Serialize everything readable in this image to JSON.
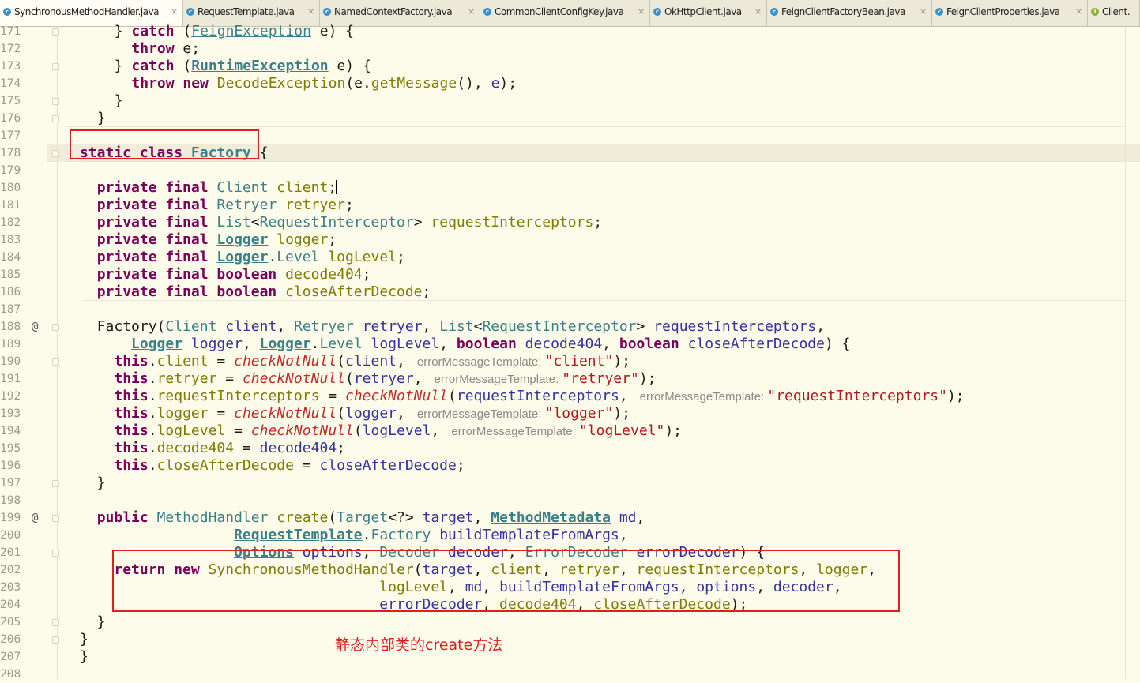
{
  "tabs": [
    {
      "label": "SynchronousMethodHandler.java",
      "icon": "class-icon",
      "active": true,
      "closable": true
    },
    {
      "label": "RequestTemplate.java",
      "icon": "class-icon",
      "closable": true
    },
    {
      "label": "NamedContextFactory.java",
      "icon": "class-icon",
      "closable": true
    },
    {
      "label": "CommonClientConfigKey.java",
      "icon": "class-icon",
      "closable": true
    },
    {
      "label": "OkHttpClient.java",
      "icon": "class-icon",
      "closable": true
    },
    {
      "label": "FeignClientFactoryBean.java",
      "icon": "class-icon",
      "closable": true
    },
    {
      "label": "FeignClientProperties.java",
      "icon": "class-icon",
      "closable": true
    },
    {
      "label": "Client.",
      "icon": "interface-icon",
      "closable": false
    }
  ],
  "tab_close_glyph": "×",
  "gutter_marks": {
    "188": "@",
    "199": "@"
  },
  "current_line": "180",
  "lines": [
    {
      "n": "171",
      "tokens": [
        [
          "  } ",
          ""
        ],
        [
          "catch",
          "kw"
        ],
        [
          " (",
          ""
        ],
        [
          "FeignException",
          "ty ul"
        ],
        [
          " e) {",
          ""
        ]
      ]
    },
    {
      "n": "172",
      "tokens": [
        [
          "    ",
          ""
        ],
        [
          "throw",
          "kw"
        ],
        [
          " e;",
          ""
        ]
      ]
    },
    {
      "n": "173",
      "tokens": [
        [
          "  } ",
          ""
        ],
        [
          "catch",
          "kw"
        ],
        [
          " (",
          ""
        ],
        [
          "RuntimeException",
          "ty ul bt"
        ],
        [
          " e) {",
          ""
        ]
      ]
    },
    {
      "n": "174",
      "tokens": [
        [
          "    ",
          ""
        ],
        [
          "throw new",
          "kw"
        ],
        [
          " ",
          ""
        ],
        [
          "DecodeException",
          "fn"
        ],
        [
          "(e.",
          ""
        ],
        [
          "getMessage",
          "fn"
        ],
        [
          "(), ",
          ""
        ],
        [
          "e",
          "fd"
        ],
        [
          ");",
          ""
        ]
      ]
    },
    {
      "n": "175",
      "tokens": [
        [
          "  }",
          ""
        ]
      ]
    },
    {
      "n": "176",
      "tokens": [
        [
          "}",
          ""
        ]
      ]
    },
    {
      "n": "177",
      "tokens": []
    },
    {
      "n": "178",
      "tokens": [
        [
          "static class",
          "kw"
        ],
        [
          " ",
          ""
        ],
        [
          "Factory",
          "ty ul bt"
        ],
        [
          " {",
          ""
        ]
      ]
    },
    {
      "n": "179",
      "tokens": []
    },
    {
      "n": "180",
      "tokens": [
        [
          "  ",
          ""
        ],
        [
          "private final",
          "kw"
        ],
        [
          " ",
          ""
        ],
        [
          "Client",
          "ty"
        ],
        [
          " ",
          ""
        ],
        [
          "client",
          "fn"
        ],
        [
          ";",
          ""
        ]
      ],
      "caret": true
    },
    {
      "n": "181",
      "tokens": [
        [
          "  ",
          ""
        ],
        [
          "private final",
          "kw"
        ],
        [
          " ",
          ""
        ],
        [
          "Retryer",
          "ty"
        ],
        [
          " ",
          ""
        ],
        [
          "retryer",
          "fn"
        ],
        [
          ";",
          ""
        ]
      ]
    },
    {
      "n": "182",
      "tokens": [
        [
          "  ",
          ""
        ],
        [
          "private final",
          "kw"
        ],
        [
          " ",
          ""
        ],
        [
          "List",
          "ty"
        ],
        [
          "<",
          ""
        ],
        [
          "RequestInterceptor",
          "ty"
        ],
        [
          "> ",
          ""
        ],
        [
          "requestInterceptors",
          "fn"
        ],
        [
          ";",
          ""
        ]
      ]
    },
    {
      "n": "183",
      "tokens": [
        [
          "  ",
          ""
        ],
        [
          "private final",
          "kw"
        ],
        [
          " ",
          ""
        ],
        [
          "Logger",
          "ty ul bt"
        ],
        [
          " ",
          ""
        ],
        [
          "logger",
          "fn"
        ],
        [
          ";",
          ""
        ]
      ]
    },
    {
      "n": "184",
      "tokens": [
        [
          "  ",
          ""
        ],
        [
          "private final",
          "kw"
        ],
        [
          " ",
          ""
        ],
        [
          "Logger",
          "ty ul bt"
        ],
        [
          ".",
          ""
        ],
        [
          "Level",
          "ty"
        ],
        [
          " ",
          ""
        ],
        [
          "logLevel",
          "fn"
        ],
        [
          ";",
          ""
        ]
      ]
    },
    {
      "n": "185",
      "tokens": [
        [
          "  ",
          ""
        ],
        [
          "private final boolean",
          "kw"
        ],
        [
          " ",
          ""
        ],
        [
          "decode404",
          "fn"
        ],
        [
          ";",
          ""
        ]
      ]
    },
    {
      "n": "186",
      "tokens": [
        [
          "  ",
          ""
        ],
        [
          "private final boolean",
          "kw"
        ],
        [
          " ",
          ""
        ],
        [
          "closeAfterDecode",
          "fn"
        ],
        [
          ";",
          ""
        ]
      ]
    },
    {
      "n": "187",
      "tokens": []
    },
    {
      "n": "188",
      "tokens": [
        [
          "  ",
          ""
        ],
        [
          "Factory",
          ""
        ],
        [
          "(",
          ""
        ],
        [
          "Client",
          "ty"
        ],
        [
          " ",
          ""
        ],
        [
          "client",
          "fd"
        ],
        [
          ", ",
          ""
        ],
        [
          "Retryer",
          "ty"
        ],
        [
          " ",
          ""
        ],
        [
          "retryer",
          "fd"
        ],
        [
          ", ",
          ""
        ],
        [
          "List",
          "ty"
        ],
        [
          "<",
          ""
        ],
        [
          "RequestInterceptor",
          "ty"
        ],
        [
          "> ",
          ""
        ],
        [
          "requestInterceptors",
          "fd"
        ],
        [
          ",",
          ""
        ]
      ]
    },
    {
      "n": "189",
      "tokens": [
        [
          "      ",
          ""
        ],
        [
          "Logger",
          "ty ul bt"
        ],
        [
          " ",
          ""
        ],
        [
          "logger",
          "fd"
        ],
        [
          ", ",
          ""
        ],
        [
          "Logger",
          "ty ul bt"
        ],
        [
          ".",
          ""
        ],
        [
          "Level",
          "ty"
        ],
        [
          " ",
          ""
        ],
        [
          "logLevel",
          "fd"
        ],
        [
          ", ",
          ""
        ],
        [
          "boolean",
          "kw"
        ],
        [
          " ",
          ""
        ],
        [
          "decode404",
          "fd"
        ],
        [
          ", ",
          ""
        ],
        [
          "boolean",
          "kw"
        ],
        [
          " ",
          ""
        ],
        [
          "closeAfterDecode",
          "fd"
        ],
        [
          ") {",
          ""
        ]
      ]
    },
    {
      "n": "190",
      "tokens": [
        [
          "    ",
          ""
        ],
        [
          "this",
          "kw"
        ],
        [
          ".",
          ""
        ],
        [
          "client",
          "fn"
        ],
        [
          " = ",
          ""
        ],
        [
          "checkNotNull",
          "it"
        ],
        [
          "(",
          ""
        ],
        [
          "client",
          "fd"
        ],
        [
          ", ",
          ""
        ],
        [
          " errorMessageTemplate: ",
          "hint"
        ],
        [
          "\"client\"",
          "st"
        ],
        [
          ");",
          ""
        ]
      ]
    },
    {
      "n": "191",
      "tokens": [
        [
          "    ",
          ""
        ],
        [
          "this",
          "kw"
        ],
        [
          ".",
          ""
        ],
        [
          "retryer",
          "fn"
        ],
        [
          " = ",
          ""
        ],
        [
          "checkNotNull",
          "it"
        ],
        [
          "(",
          ""
        ],
        [
          "retryer",
          "fd"
        ],
        [
          ", ",
          ""
        ],
        [
          " errorMessageTemplate: ",
          "hint"
        ],
        [
          "\"retryer\"",
          "st"
        ],
        [
          ");",
          ""
        ]
      ]
    },
    {
      "n": "192",
      "tokens": [
        [
          "    ",
          ""
        ],
        [
          "this",
          "kw"
        ],
        [
          ".",
          ""
        ],
        [
          "requestInterceptors",
          "fn"
        ],
        [
          " = ",
          ""
        ],
        [
          "checkNotNull",
          "it"
        ],
        [
          "(",
          ""
        ],
        [
          "requestInterceptors",
          "fd"
        ],
        [
          ", ",
          ""
        ],
        [
          " errorMessageTemplate: ",
          "hint"
        ],
        [
          "\"requestInterceptors\"",
          "st"
        ],
        [
          ");",
          ""
        ]
      ]
    },
    {
      "n": "193",
      "tokens": [
        [
          "    ",
          ""
        ],
        [
          "this",
          "kw"
        ],
        [
          ".",
          ""
        ],
        [
          "logger",
          "fn"
        ],
        [
          " = ",
          ""
        ],
        [
          "checkNotNull",
          "it"
        ],
        [
          "(",
          ""
        ],
        [
          "logger",
          "fd"
        ],
        [
          ", ",
          ""
        ],
        [
          " errorMessageTemplate: ",
          "hint"
        ],
        [
          "\"logger\"",
          "st"
        ],
        [
          ");",
          ""
        ]
      ]
    },
    {
      "n": "194",
      "tokens": [
        [
          "    ",
          ""
        ],
        [
          "this",
          "kw"
        ],
        [
          ".",
          ""
        ],
        [
          "logLevel",
          "fn"
        ],
        [
          " = ",
          ""
        ],
        [
          "checkNotNull",
          "it"
        ],
        [
          "(",
          ""
        ],
        [
          "logLevel",
          "fd"
        ],
        [
          ", ",
          ""
        ],
        [
          " errorMessageTemplate: ",
          "hint"
        ],
        [
          "\"logLevel\"",
          "st"
        ],
        [
          ");",
          ""
        ]
      ]
    },
    {
      "n": "195",
      "tokens": [
        [
          "    ",
          ""
        ],
        [
          "this",
          "kw"
        ],
        [
          ".",
          ""
        ],
        [
          "decode404",
          "fn"
        ],
        [
          " = ",
          ""
        ],
        [
          "decode404",
          "fd"
        ],
        [
          ";",
          ""
        ]
      ]
    },
    {
      "n": "196",
      "tokens": [
        [
          "    ",
          ""
        ],
        [
          "this",
          "kw"
        ],
        [
          ".",
          ""
        ],
        [
          "closeAfterDecode",
          "fn"
        ],
        [
          " = ",
          ""
        ],
        [
          "closeAfterDecode",
          "fd"
        ],
        [
          ";",
          ""
        ]
      ]
    },
    {
      "n": "197",
      "tokens": [
        [
          "  }",
          ""
        ]
      ]
    },
    {
      "n": "198",
      "tokens": []
    },
    {
      "n": "199",
      "tokens": [
        [
          "  ",
          ""
        ],
        [
          "public",
          "kw"
        ],
        [
          " ",
          ""
        ],
        [
          "MethodHandler",
          "ty"
        ],
        [
          " ",
          ""
        ],
        [
          "create",
          "fn"
        ],
        [
          "(",
          ""
        ],
        [
          "Target",
          "ty"
        ],
        [
          "<?> ",
          ""
        ],
        [
          "target",
          "fd"
        ],
        [
          ", ",
          ""
        ],
        [
          "MethodMetadata",
          "ty ul bt"
        ],
        [
          " ",
          ""
        ],
        [
          "md",
          "fd"
        ],
        [
          ",",
          ""
        ]
      ]
    },
    {
      "n": "200",
      "tokens": [
        [
          "                  ",
          ""
        ],
        [
          "RequestTemplate",
          "ty ul bt"
        ],
        [
          ".",
          ""
        ],
        [
          "Factory",
          "ty"
        ],
        [
          " ",
          ""
        ],
        [
          "buildTemplateFromArgs",
          "fd"
        ],
        [
          ",",
          ""
        ]
      ]
    },
    {
      "n": "201",
      "tokens": [
        [
          "                  ",
          ""
        ],
        [
          "Options",
          "ty ul bt"
        ],
        [
          " ",
          ""
        ],
        [
          "options",
          "fd"
        ],
        [
          ", ",
          ""
        ],
        [
          "Decoder",
          "ty"
        ],
        [
          " ",
          ""
        ],
        [
          "decoder",
          "fd"
        ],
        [
          ", ",
          ""
        ],
        [
          "ErrorDecoder",
          "ty"
        ],
        [
          " ",
          ""
        ],
        [
          "errorDecoder",
          "fd"
        ],
        [
          ") {",
          ""
        ]
      ]
    },
    {
      "n": "202",
      "tokens": [
        [
          "    ",
          ""
        ],
        [
          "return new",
          "kw"
        ],
        [
          " ",
          ""
        ],
        [
          "SynchronousMethodHandler",
          "fn"
        ],
        [
          "(",
          ""
        ],
        [
          "target",
          "fd"
        ],
        [
          ", ",
          ""
        ],
        [
          "client",
          "fn"
        ],
        [
          ", ",
          ""
        ],
        [
          "retryer",
          "fn"
        ],
        [
          ", ",
          ""
        ],
        [
          "requestInterceptors",
          "fn"
        ],
        [
          ", ",
          ""
        ],
        [
          "logger",
          "fn"
        ],
        [
          ",",
          ""
        ]
      ]
    },
    {
      "n": "203",
      "tokens": [
        [
          "                                   ",
          ""
        ],
        [
          "logLevel",
          "fn"
        ],
        [
          ", ",
          ""
        ],
        [
          "md",
          "fd"
        ],
        [
          ", ",
          ""
        ],
        [
          "buildTemplateFromArgs",
          "fd"
        ],
        [
          ", ",
          ""
        ],
        [
          "options",
          "fd"
        ],
        [
          ", ",
          ""
        ],
        [
          "decoder",
          "fd"
        ],
        [
          ",",
          ""
        ]
      ]
    },
    {
      "n": "204",
      "tokens": [
        [
          "                                   ",
          ""
        ],
        [
          "errorDecoder",
          "fd"
        ],
        [
          ", ",
          ""
        ],
        [
          "decode404",
          "fn"
        ],
        [
          ", ",
          ""
        ],
        [
          "closeAfterDecode",
          "fn"
        ],
        [
          ");",
          ""
        ]
      ]
    },
    {
      "n": "205",
      "tokens": [
        [
          "  }",
          ""
        ]
      ]
    },
    {
      "n": "206",
      "tokens": [
        [
          "}",
          ""
        ]
      ]
    },
    {
      "n": "207",
      "tokens": [
        [
          "}",
          ""
        ]
      ]
    },
    {
      "n": "208",
      "tokens": []
    }
  ],
  "annotation_note": "静态内部类的create方法"
}
